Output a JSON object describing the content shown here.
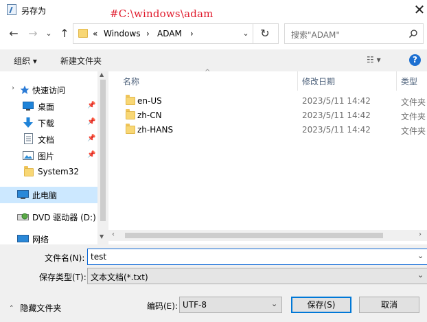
{
  "window": {
    "title": "另存为",
    "watermark": "#C:\\windows\\adam",
    "close_glyph": "✕"
  },
  "nav": {
    "back_glyph": "←",
    "forward_glyph": "→",
    "history_glyph": "⌄",
    "up_glyph": "↑",
    "breadcrumb": {
      "overflow": "«",
      "segments": [
        "Windows",
        "ADAM"
      ],
      "separator": "›",
      "dropdown_glyph": "⌄"
    },
    "refresh_glyph": "↻",
    "search_placeholder": "搜索\"ADAM\""
  },
  "toolbar": {
    "organize_label": "组织 ▾",
    "new_folder_label": "新建文件夹",
    "view_glyph": "☷ ▾",
    "help_glyph": "?"
  },
  "sidebar": {
    "items": [
      {
        "label": "快速访问",
        "icon": "star-icon",
        "pinned": false,
        "expand": "›"
      },
      {
        "label": "桌面",
        "icon": "desktop-icon",
        "pinned": true
      },
      {
        "label": "下载",
        "icon": "download-icon",
        "pinned": true
      },
      {
        "label": "文档",
        "icon": "document-icon",
        "pinned": true
      },
      {
        "label": "图片",
        "icon": "picture-icon",
        "pinned": true
      },
      {
        "label": "System32",
        "icon": "folder-icon",
        "pinned": false
      },
      {
        "label": "此电脑",
        "icon": "computer-icon",
        "pinned": false,
        "selected": true
      },
      {
        "label": "DVD 驱动器 (D:)",
        "icon": "dvd-icon",
        "pinned": false
      },
      {
        "label": "网络",
        "icon": "network-icon",
        "pinned": false
      }
    ],
    "pin_glyph": "📌"
  },
  "files": {
    "columns": [
      "名称",
      "修改日期",
      "类型"
    ],
    "rows": [
      {
        "name": "en-US",
        "date": "2023/5/11 14:42",
        "type": "文件夹"
      },
      {
        "name": "zh-CN",
        "date": "2023/5/11 14:42",
        "type": "文件夹"
      },
      {
        "name": "zh-HANS",
        "date": "2023/5/11 14:42",
        "type": "文件夹"
      }
    ]
  },
  "form": {
    "filename_label": "文件名(N):",
    "filename_value": "test",
    "filetype_label": "保存类型(T):",
    "filetype_value": "文本文档(*.txt)",
    "hide_folders_label": "隐藏文件夹",
    "encoding_label": "编码(E):",
    "encoding_value": "UTF-8",
    "save_label": "保存(S)",
    "cancel_label": "取消"
  },
  "colors": {
    "accent": "#0078d7",
    "selected_bg": "#cce8ff",
    "folder": "#f8d775",
    "watermark": "#e0192b"
  }
}
